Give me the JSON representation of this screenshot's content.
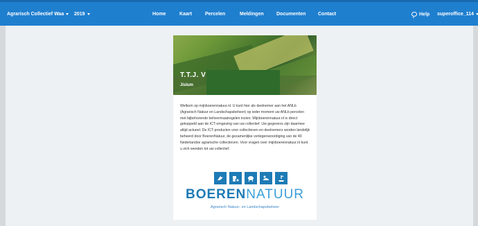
{
  "navbar": {
    "collective": "Agrarisch Collectief Waa",
    "year": "2019",
    "links": [
      "Home",
      "Kaart",
      "Percelen",
      "Meldingen",
      "Documenten",
      "Contact"
    ],
    "help": "Help",
    "user": "superoffice_114"
  },
  "card": {
    "title": "T.T.J. V",
    "subtitle": "Jislum",
    "intro": "Welkom op mijnboerennatuur.nl. U kunt hier als deelnemer aan het ANLb (Agrarisch Natuur en Landschapsbeheer) op ieder moment uw ANLb percelen met bijbehorende beheermaatregelen inzien. Mijnboerennatuur.nl is direct gekoppeld aan de ICT-omgeving van uw collectief. Uw gegevens zijn daarmee altijd actueel. De ICT-producten voor collectieven en deelnemers worden landelijk beheerd door BoerenNatuur, de gezamenlijke vertegenwoordiging van de 40 Nederlandse agrarische collectieven. Voor vragen over mijnboerennatuur.nl kunt u zich wenden tot uw collectief."
  },
  "logo": {
    "bold": "BOEREN",
    "light": "NATUUR",
    "tagline": "Agrarisch Natuur- en Landschapsbeheer",
    "icons": [
      "bird-icon",
      "tractor-icon",
      "cow-icon",
      "duck-icon",
      "hand-plant-icon"
    ]
  },
  "colors": {
    "navbar": "#1f7fcf",
    "brand": "#1e7bb5"
  }
}
